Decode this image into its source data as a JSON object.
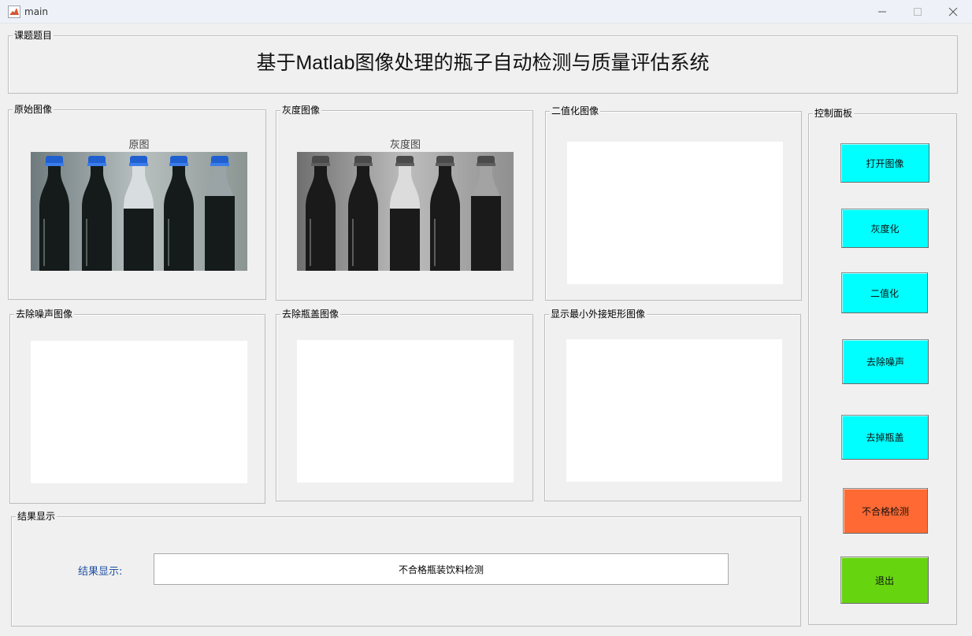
{
  "window": {
    "title": "main"
  },
  "title_panel": {
    "label": "课题题目",
    "text": "基于Matlab图像处理的瓶子自动检测与质量评估系统"
  },
  "panels": {
    "original": {
      "label": "原始图像",
      "axes_title": "原图"
    },
    "gray": {
      "label": "灰度图像",
      "axes_title": "灰度图"
    },
    "binary": {
      "label": "二值化图像"
    },
    "denoise": {
      "label": "去除噪声图像"
    },
    "cap_removed": {
      "label": "去除瓶盖图像"
    },
    "min_rect": {
      "label": "显示最小外接矩形图像"
    },
    "result": {
      "label": "结果显示",
      "field_label": "结果显示:",
      "value": "不合格瓶装饮料检测"
    }
  },
  "control": {
    "label": "控制面板",
    "buttons": {
      "open": "打开图像",
      "gray": "灰度化",
      "binarize": "二值化",
      "denoise": "去除噪声",
      "remove_cap": "去掉瓶盖",
      "detect": "不合格检测",
      "exit": "退出"
    }
  },
  "colors": {
    "cyan": "#00ffff",
    "orange": "#ff6933",
    "green": "#66d510"
  }
}
